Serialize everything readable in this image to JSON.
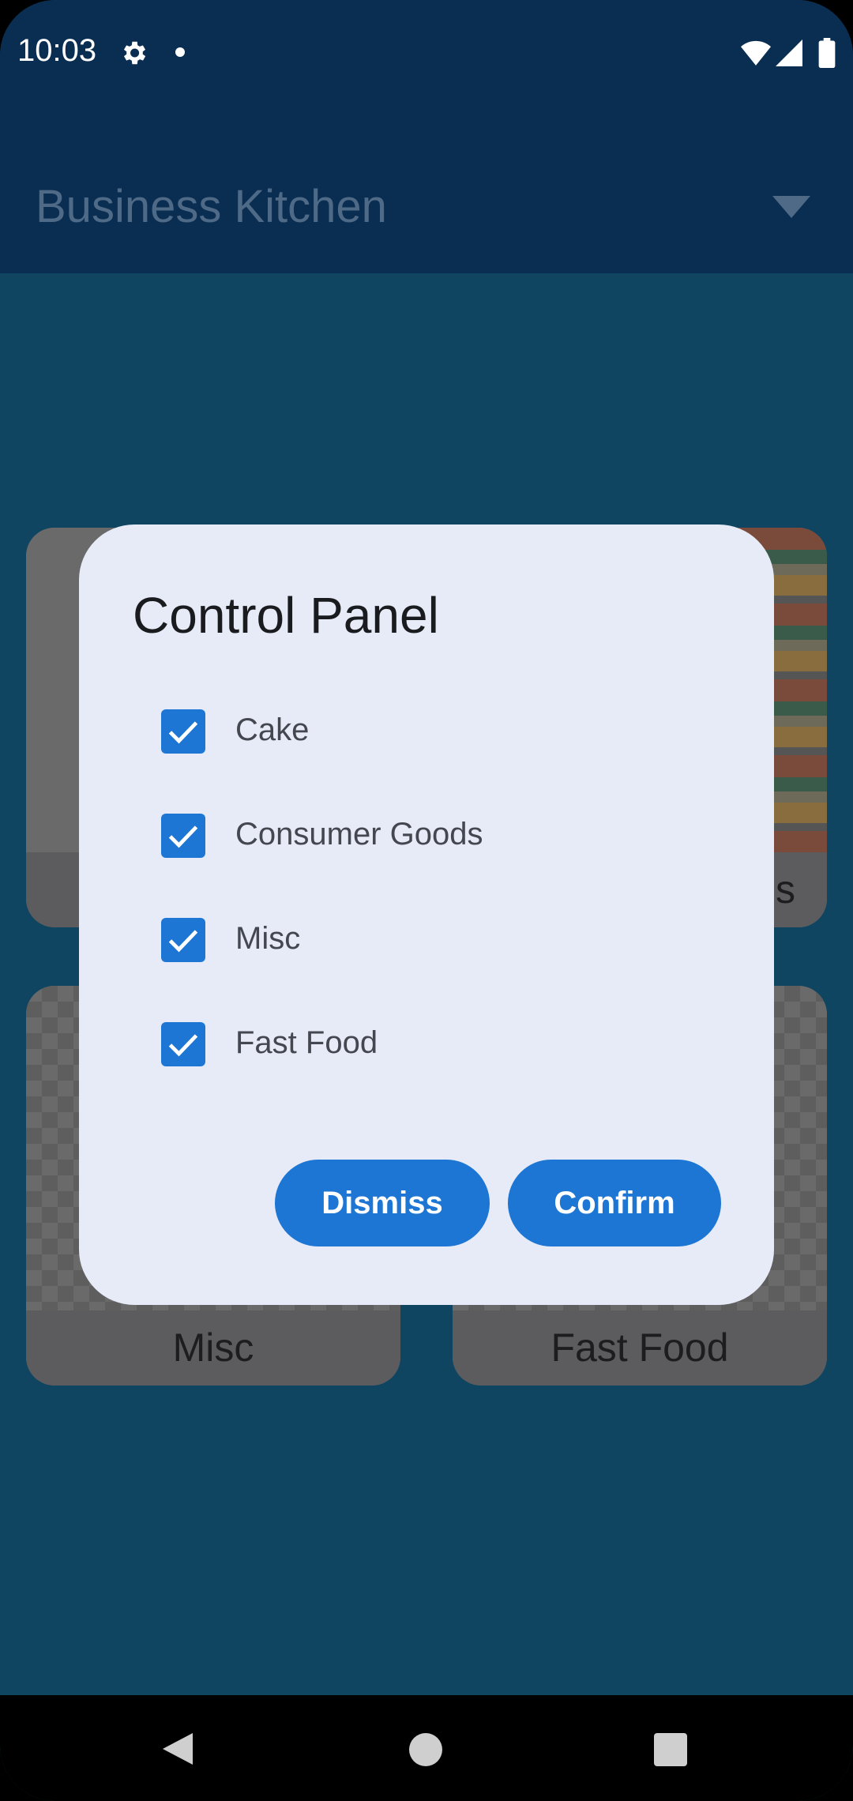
{
  "status_bar": {
    "time": "10:03",
    "icons": [
      "gear-icon",
      "dot-icon",
      "wifi-icon",
      "signal-icon",
      "battery-icon"
    ]
  },
  "app_bar": {
    "title": "Business Kitchen",
    "dropdown_icon": "caret-down-icon"
  },
  "grid": {
    "cards": [
      {
        "label": ""
      },
      {
        "label": "s"
      },
      {
        "label": "Misc"
      },
      {
        "label": "Fast Food"
      }
    ]
  },
  "dialog": {
    "title": "Control Panel",
    "options": [
      {
        "label": "Cake",
        "checked": true
      },
      {
        "label": "Consumer Goods",
        "checked": true
      },
      {
        "label": "Misc",
        "checked": true
      },
      {
        "label": "Fast Food",
        "checked": true
      }
    ],
    "dismiss_label": "Dismiss",
    "confirm_label": "Confirm"
  },
  "nav_bar": {
    "icons": [
      "back-icon",
      "home-icon",
      "recents-icon"
    ]
  },
  "colors": {
    "app_bar": "#0a2d52",
    "background": "#0f4560",
    "dialog": "#e6ebf7",
    "accent": "#1e76d4"
  }
}
